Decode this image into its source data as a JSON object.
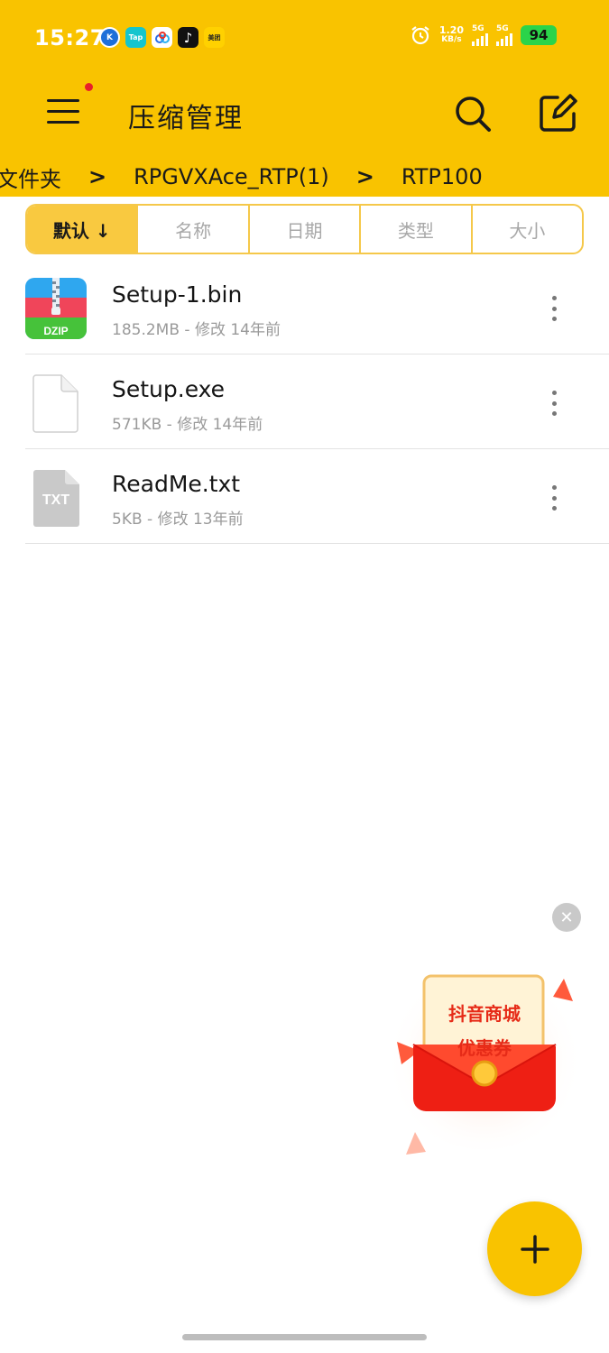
{
  "status_bar": {
    "time": "15:27",
    "apps": [
      {
        "icon": "k-app-icon",
        "label": "K",
        "color": "#1e6fd9"
      },
      {
        "icon": "taptap-icon",
        "label": "Tap",
        "color": "#15c5ce"
      },
      {
        "icon": "baidu-netdisk-icon",
        "label": "",
        "color": "#ffffff"
      },
      {
        "icon": "tiktok-icon",
        "label": "",
        "color": "#111111"
      },
      {
        "icon": "meituan-icon",
        "label": "美团",
        "color": "#ffd100"
      }
    ],
    "net_speed_value": "1.20",
    "net_speed_unit": "KB/s",
    "signal1_label": "5G",
    "signal2_label": "5G",
    "battery": "94"
  },
  "header": {
    "title": "压缩管理"
  },
  "breadcrumb": {
    "items": [
      "文件夹",
      "RPGVXAce_RTP(1)",
      "RTP100"
    ]
  },
  "sort": {
    "tabs": [
      "默认 ↓",
      "名称",
      "日期",
      "类型",
      "大小"
    ]
  },
  "files": [
    {
      "name": "Setup-1.bin",
      "meta": "185.2MB - 修改 14年前",
      "icon": "dzip-archive-icon",
      "icon_label": "DZIP"
    },
    {
      "name": "Setup.exe",
      "meta": "571KB - 修改 14年前",
      "icon": "blank-file-icon"
    },
    {
      "name": "ReadMe.txt",
      "meta": "5KB - 修改 13年前",
      "icon": "txt-file-icon",
      "icon_label": "TXT"
    }
  ],
  "promo": {
    "line1": "抖音商城",
    "line2": "优惠券"
  },
  "colors": {
    "accent": "#f9c300",
    "sort_active": "#f9c940",
    "promo_red": "#e62b18"
  }
}
